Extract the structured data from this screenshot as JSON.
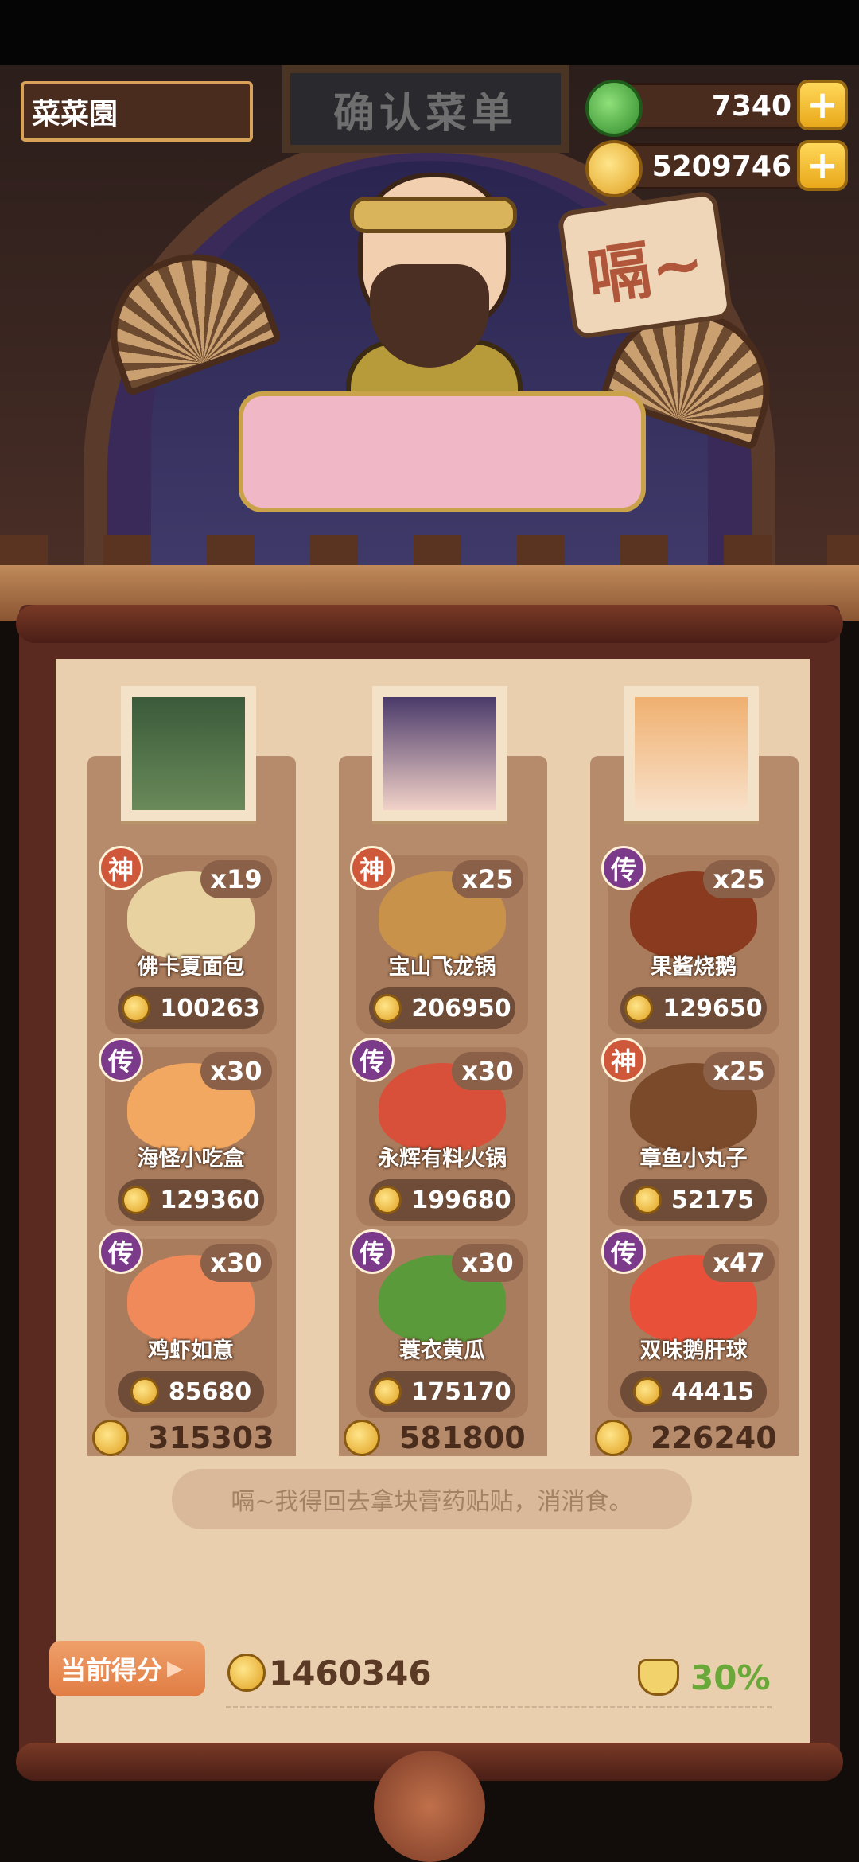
{
  "header": {
    "player_name": "菜菜園",
    "sign_text": "确认菜单",
    "jade_amount": "7340",
    "coin_amount": "5209746",
    "plus_symbol": "+"
  },
  "guest": {
    "speech": "嗝~"
  },
  "columns": [
    {
      "items": [
        {
          "rarity": "神",
          "rarity_type": "shen",
          "count": "x19",
          "name": "佛卡夏面包",
          "price": "100263",
          "food_color": "#e8d2a0"
        },
        {
          "rarity": "传",
          "rarity_type": "chuan",
          "count": "x30",
          "name": "海怪小吃盒",
          "price": "129360",
          "food_color": "#f2a860"
        },
        {
          "rarity": "传",
          "rarity_type": "chuan",
          "count": "x30",
          "name": "鸡虾如意",
          "price": "85680",
          "food_color": "#f08a5a"
        }
      ],
      "total": "315303"
    },
    {
      "items": [
        {
          "rarity": "神",
          "rarity_type": "shen",
          "count": "x25",
          "name": "宝山飞龙锅",
          "price": "206950",
          "food_color": "#c8924a"
        },
        {
          "rarity": "传",
          "rarity_type": "chuan",
          "count": "x30",
          "name": "永辉有料火锅",
          "price": "199680",
          "food_color": "#d8503a"
        },
        {
          "rarity": "传",
          "rarity_type": "chuan",
          "count": "x30",
          "name": "蓑衣黄瓜",
          "price": "175170",
          "food_color": "#5a9a3a"
        }
      ],
      "total": "581800"
    },
    {
      "items": [
        {
          "rarity": "传",
          "rarity_type": "chuan",
          "count": "x25",
          "name": "果酱烧鹅",
          "price": "129650",
          "food_color": "#8a3a1e"
        },
        {
          "rarity": "神",
          "rarity_type": "shen",
          "count": "x25",
          "name": "章鱼小丸子",
          "price": "52175",
          "food_color": "#7a4a2a"
        },
        {
          "rarity": "传",
          "rarity_type": "chuan",
          "count": "x47",
          "name": "双味鹅肝球",
          "price": "44415",
          "food_color": "#e8503a"
        }
      ],
      "total": "226240"
    }
  ],
  "quote": "嗝~我得回去拿块膏药贴贴，消消食。",
  "score": {
    "label": "当前得分",
    "arrow": "▶",
    "value": "1460346",
    "bonus": "30%"
  }
}
